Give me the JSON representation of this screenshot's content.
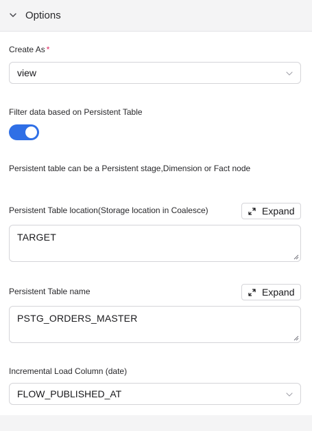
{
  "header": {
    "title": "Options",
    "icon": "chevron-down-icon"
  },
  "create_as": {
    "label": "Create As",
    "required_mark": "*",
    "value": "view"
  },
  "filter": {
    "label": "Filter data based on Persistent Table",
    "toggle_on": true
  },
  "info_text": "Persistent table can be a Persistent stage,Dimension or Fact node",
  "location": {
    "label": "Persistent Table location(Storage location in Coalesce)",
    "expand_label": "Expand",
    "value": "TARGET"
  },
  "table_name": {
    "label": "Persistent Table name",
    "expand_label": "Expand",
    "value": "PSTG_ORDERS_MASTER"
  },
  "incremental": {
    "label": "Incremental Load Column (date)",
    "value": "FLOW_PUBLISHED_AT"
  },
  "colors": {
    "accent": "#2f6fe6",
    "required": "#e0245e"
  }
}
